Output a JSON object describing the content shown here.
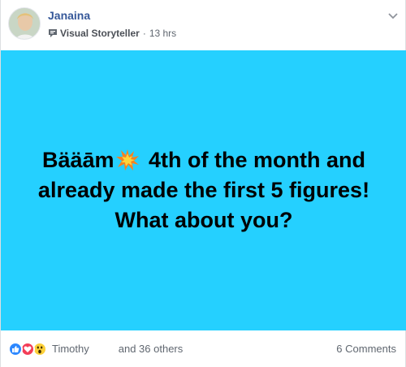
{
  "post": {
    "author": "Janaina",
    "badge_icon": "speech-bubble-badge-icon",
    "badge_label": "Visual Storyteller",
    "separator": "·",
    "time": "13 hrs",
    "image": {
      "background": "#25d0ff",
      "text_before_emoji": "Bääām",
      "emoji_icon": "collision-burst-icon",
      "text_after_emoji": " 4th of the month and already made the first 5 figures! What about you?"
    }
  },
  "footer": {
    "reaction_icons": [
      "like-icon",
      "love-icon",
      "wow-icon"
    ],
    "reactor_name": "Timothy",
    "others": "and 36 others",
    "comments": "6 Comments"
  },
  "colors": {
    "author_link": "#365899",
    "meta_text": "#606770",
    "like": "#2d88ff",
    "love": "#f33e58",
    "wow": "#fcd03a"
  }
}
